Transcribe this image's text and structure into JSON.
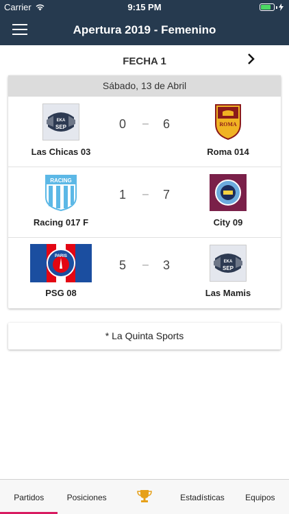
{
  "status_bar": {
    "carrier": "Carrier",
    "time": "9:15 PM",
    "battery_level": 0.8,
    "battery_color": "#4cd964"
  },
  "nav": {
    "title": "Apertura 2019 - Femenino",
    "menu_icon": "hamburger-icon"
  },
  "round": {
    "label": "FECHA 1",
    "next_icon": "chevron-right-icon"
  },
  "date_header": "Sábado, 13 de Abril",
  "matches": [
    {
      "home": {
        "name": "Las Chicas 03",
        "logo": "sep-crest"
      },
      "home_score": "0",
      "away_score": "6",
      "away": {
        "name": "Roma 014",
        "logo": "roma-crest"
      }
    },
    {
      "home": {
        "name": "Racing 017 F",
        "logo": "racing-crest"
      },
      "home_score": "1",
      "away_score": "7",
      "away": {
        "name": "City 09",
        "logo": "city-crest"
      }
    },
    {
      "home": {
        "name": "PSG 08",
        "logo": "psg-crest"
      },
      "home_score": "5",
      "away_score": "3",
      "away": {
        "name": "Las Mamis",
        "logo": "sep-crest"
      }
    }
  ],
  "score_separator": "–",
  "sponsor": "* La Quinta Sports",
  "tabs": [
    {
      "label": "Partidos",
      "active": true
    },
    {
      "label": "Posiciones",
      "active": false
    },
    {
      "label": "",
      "icon": "trophy-icon",
      "active": false
    },
    {
      "label": "Estadísticas",
      "active": false
    },
    {
      "label": "Equipos",
      "active": false
    }
  ],
  "colors": {
    "nav_bg": "#263a4f",
    "accent": "#d81b60",
    "trophy": "#e6a019"
  },
  "sep_logo": {
    "line1": "EKA",
    "line2": "SEP"
  },
  "racing_logo": {
    "text": "RACING"
  },
  "roma_logo": {
    "text": "ROMA"
  },
  "psg_logo": {
    "text": "PARIS"
  }
}
